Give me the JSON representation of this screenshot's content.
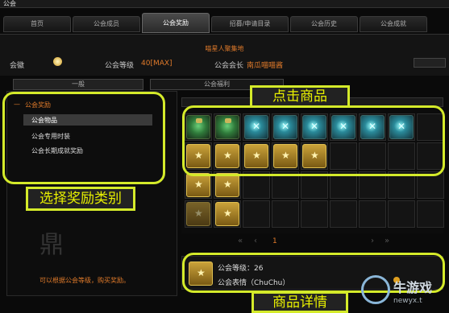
{
  "window": {
    "title": "公会"
  },
  "tabs": [
    {
      "label": "首页"
    },
    {
      "label": "公会成员"
    },
    {
      "label": "公会奖励"
    },
    {
      "label": "招募/申请目录"
    },
    {
      "label": "公会历史"
    },
    {
      "label": "公会成就"
    }
  ],
  "guild": {
    "name": "喵星人聚集地",
    "emblem_label": "会徽",
    "level_label": "公会等级",
    "level_value": "40[MAX]",
    "leader_label": "公会会长",
    "leader_value": "南瓜喵喵酱"
  },
  "subtabs": [
    {
      "label": "一般"
    },
    {
      "label": "公会福利"
    }
  ],
  "categories": {
    "root": "公会奖励",
    "items": [
      {
        "label": "公会物品"
      },
      {
        "label": "公会专用时装"
      },
      {
        "label": "公会长期成就奖励"
      }
    ]
  },
  "footer_note": "可以根据公会等级，购买奖励。",
  "pagination": {
    "page": "1"
  },
  "annotations": {
    "click_item": "点击商品",
    "select_category": "选择奖励类别",
    "item_detail": "商品详情"
  },
  "detail": {
    "level_line": "公会等级：26",
    "name_line": "公会表情（ChuChu）"
  },
  "watermark": {
    "brand": "牛游戏",
    "url": "newyx.t"
  }
}
